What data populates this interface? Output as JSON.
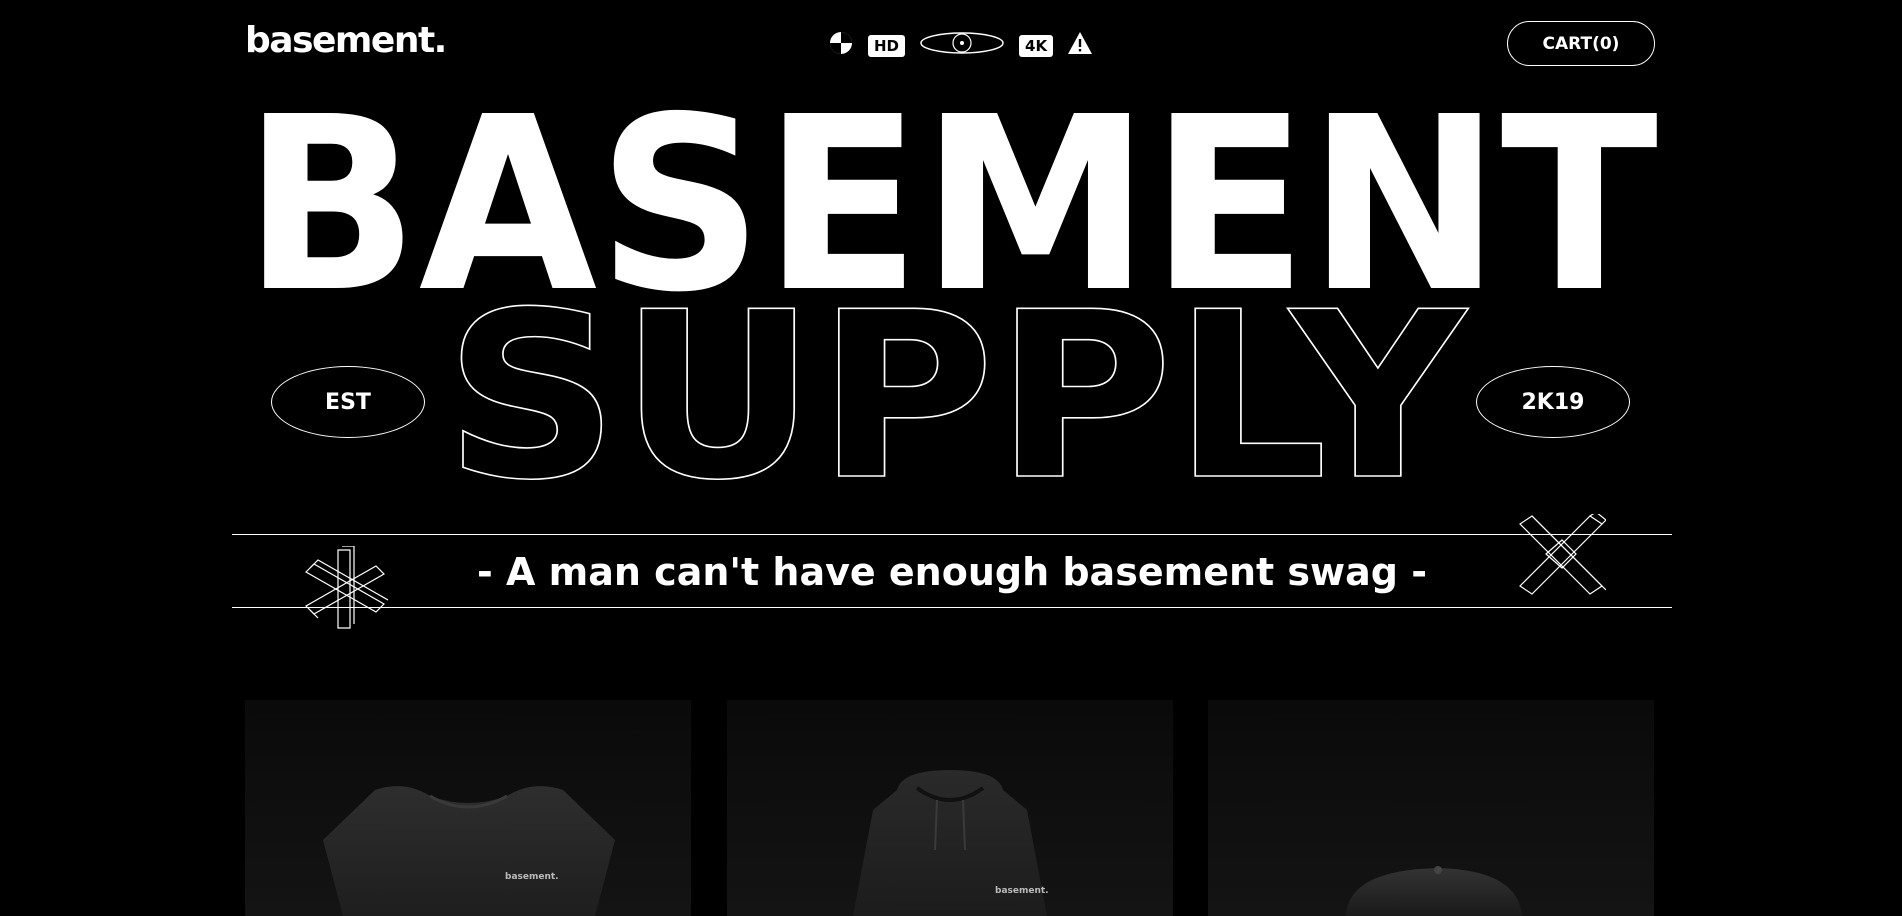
{
  "header": {
    "logo": "basement.",
    "badges": [
      "HD",
      "4K"
    ],
    "badge_icons": [
      "contrast-circle-icon",
      "eye-ellipse-icon",
      "warning-triangle-icon"
    ],
    "cart_label": "CART(0)"
  },
  "hero": {
    "title": "BASEMENT",
    "subtitle": "SUPPLY",
    "est_label": "EST",
    "year_label": "2K19"
  },
  "band": {
    "tagline": "- A man can't have enough basement swag -"
  },
  "products": [
    {
      "name": "t-shirt",
      "print": "basement."
    },
    {
      "name": "hoodie",
      "print": "basement."
    },
    {
      "name": "cap",
      "print": ""
    }
  ],
  "colors": {
    "background": "#000000",
    "foreground": "#ffffff"
  }
}
